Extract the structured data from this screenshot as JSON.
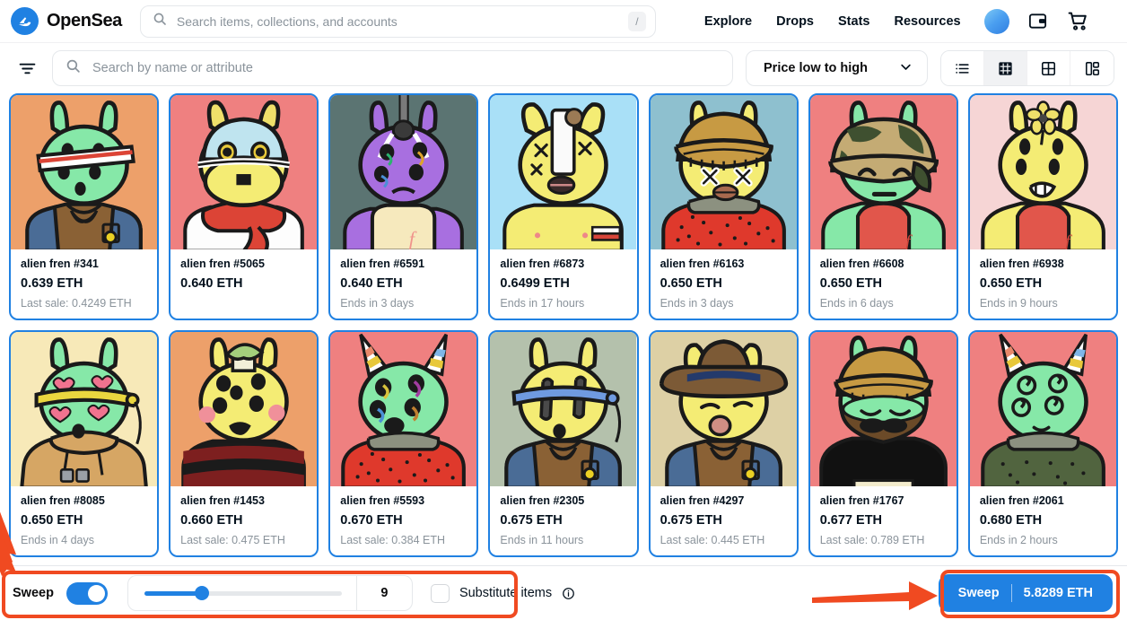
{
  "nav": {
    "brand": "OpenSea",
    "brand_logo_icon": "opensea-sail-logo",
    "search_placeholder": "Search items, collections, and accounts",
    "search_value": "",
    "search_icon": "search-icon",
    "slash_hint": "/",
    "links": [
      {
        "label": "Explore"
      },
      {
        "label": "Drops"
      },
      {
        "label": "Stats"
      },
      {
        "label": "Resources"
      }
    ],
    "icons": [
      {
        "name": "profile-avatar"
      },
      {
        "name": "wallet-icon"
      },
      {
        "name": "cart-icon"
      }
    ]
  },
  "filterbar": {
    "filter_toggle_icon": "filter-icon",
    "search_placeholder": "Search by name or attribute",
    "search_value": "",
    "search_icon": "search-icon",
    "sort_value": "Price low to high",
    "sort_chevron_icon": "chevron-down-icon",
    "views": [
      {
        "name": "list-view",
        "icon": "list-icon",
        "active": false
      },
      {
        "name": "small-grid-view",
        "icon": "grid-dense-icon",
        "active": true
      },
      {
        "name": "medium-grid-view",
        "icon": "grid-4-icon",
        "active": false
      },
      {
        "name": "detail-view",
        "icon": "grid-detail-icon",
        "active": false
      }
    ]
  },
  "items": [
    {
      "title": "alien fren #341",
      "price": "0.639 ETH",
      "sub": "Last sale: 0.4249 ETH",
      "bg": "#eda06a",
      "skin": "#86e8a8",
      "accessory": "headband-red-white",
      "outfit": "brown-jacket"
    },
    {
      "title": "alien fren #5065",
      "price": "0.640 ETH",
      "sub": "",
      "bg": "#ef8080",
      "skin": "#f4ec74",
      "accessory": "ice-helmet",
      "outfit": "red-scarf"
    },
    {
      "title": "alien fren #6591",
      "price": "0.640 ETH",
      "sub": "Ends in 3 days",
      "bg": "#5b7472",
      "skin": "#a86fe0",
      "accessory": "noose",
      "outfit": "cream-apron"
    },
    {
      "title": "alien fren #6873",
      "price": "0.6499 ETH",
      "sub": "Ends in 17 hours",
      "bg": "#a9e0f7",
      "skin": "#f4ec74",
      "accessory": "toilet-paper",
      "outfit": "bare-arm-band"
    },
    {
      "title": "alien fren #6163",
      "price": "0.650 ETH",
      "sub": "Ends in 3 days",
      "bg": "#8ec0cf",
      "skin": "#f4ec74",
      "accessory": "tan-beanie",
      "outfit": "red-speckled-sweater"
    },
    {
      "title": "alien fren #6608",
      "price": "0.650 ETH",
      "sub": "Ends in 6 days",
      "bg": "#ef8080",
      "skin": "#86e8a8",
      "accessory": "camo-helmet",
      "outfit": "red-tank"
    },
    {
      "title": "alien fren #6938",
      "price": "0.650 ETH",
      "sub": "Ends in 9 hours",
      "bg": "#f6d5d5",
      "skin": "#f4ec74",
      "accessory": "flower",
      "outfit": "red-tank"
    },
    {
      "title": "alien fren #8085",
      "price": "0.650 ETH",
      "sub": "Ends in 4 days",
      "bg": "#f7e9b8",
      "skin": "#86e8a8",
      "accessory": "yellow-headband-hearts",
      "outfit": "tan-hoodie"
    },
    {
      "title": "alien fren #1453",
      "price": "0.660 ETH",
      "sub": "Last sale: 0.475 ETH",
      "bg": "#eda06a",
      "skin": "#f4ec74",
      "accessory": "plant-pot-hat",
      "outfit": "striped-red-black-sweater"
    },
    {
      "title": "alien fren #5593",
      "price": "0.670 ETH",
      "sub": "Last sale: 0.384 ETH",
      "bg": "#ef8080",
      "skin": "#86e8a8",
      "accessory": "party-horns",
      "outfit": "red-speckled-sweater"
    },
    {
      "title": "alien fren #2305",
      "price": "0.675 ETH",
      "sub": "Ends in 11 hours",
      "bg": "#b4c1ac",
      "skin": "#f4ec74",
      "accessory": "blue-headband",
      "outfit": "brown-jacket"
    },
    {
      "title": "alien fren #4297",
      "price": "0.675 ETH",
      "sub": "Last sale: 0.445 ETH",
      "bg": "#ddd0a5",
      "skin": "#f4ec74",
      "accessory": "cowboy-hat",
      "outfit": "brown-jacket"
    },
    {
      "title": "alien fren #1767",
      "price": "0.677 ETH",
      "sub": "Last sale: 0.789 ETH",
      "bg": "#ef8080",
      "skin": "#86e8a8",
      "accessory": "tan-beanie-beard",
      "outfit": "black-sweater"
    },
    {
      "title": "alien fren #2061",
      "price": "0.680 ETH",
      "sub": "Ends in 2 hours",
      "bg": "#ef8080",
      "skin": "#86e8a8",
      "accessory": "party-horns",
      "outfit": "dark-olive-sweater"
    }
  ],
  "sweep": {
    "label": "Sweep",
    "toggle_on": true,
    "slider_value": "9",
    "slider_min": 1,
    "slider_max": 30,
    "substitute_label": "Substitute items",
    "substitute_checked": false,
    "info_icon": "info-icon",
    "button_label": "Sweep",
    "button_total": "5.8289 ETH"
  },
  "colors": {
    "accent": "#2081e2",
    "annotation": "#f04a21",
    "muted": "#8a939b",
    "text": "#04111d"
  }
}
